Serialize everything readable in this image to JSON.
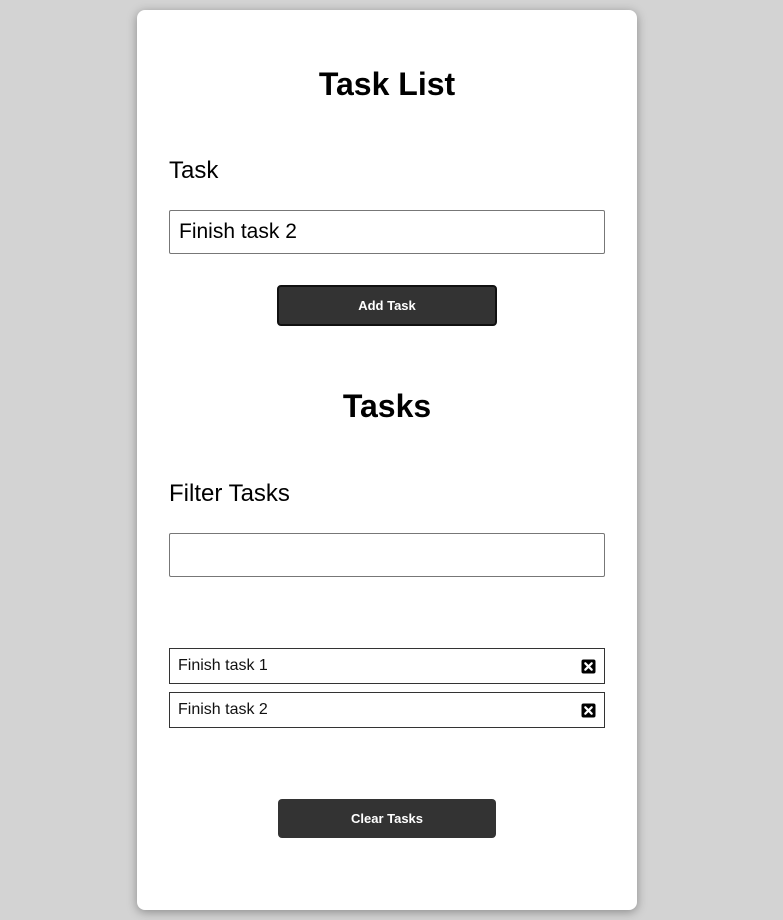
{
  "header": {
    "title": "Task List"
  },
  "task_form": {
    "label": "Task",
    "input_value": "Finish task 2",
    "add_button_label": "Add Task"
  },
  "tasks_section": {
    "title": "Tasks",
    "filter_label": "Filter Tasks",
    "filter_value": "",
    "items": [
      {
        "label": "Finish task 1",
        "delete_icon": "close-square-icon"
      },
      {
        "label": "Finish task 2",
        "delete_icon": "close-square-icon"
      }
    ],
    "clear_button_label": "Clear Tasks"
  },
  "colors": {
    "background": "#d3d3d3",
    "card": "#ffffff",
    "button": "#333333",
    "button_text": "#ffffff"
  }
}
